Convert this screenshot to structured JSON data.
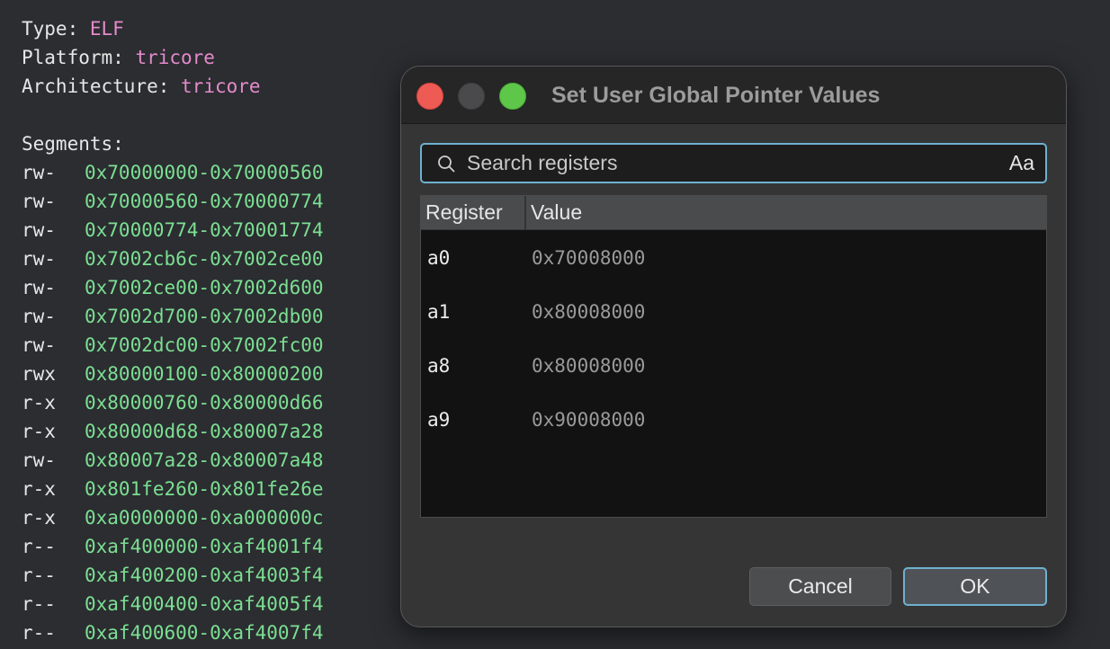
{
  "background": {
    "info": [
      {
        "label": "Type:",
        "value": "ELF"
      },
      {
        "label": "Platform:",
        "value": "tricore"
      },
      {
        "label": "Architecture:",
        "value": "tricore"
      }
    ],
    "segments_label": "Segments:",
    "segments": [
      {
        "perm": "rw-",
        "range": "0x70000000-0x70000560"
      },
      {
        "perm": "rw-",
        "range": "0x70000560-0x70000774"
      },
      {
        "perm": "rw-",
        "range": "0x70000774-0x70001774"
      },
      {
        "perm": "rw-",
        "range": "0x7002cb6c-0x7002ce00"
      },
      {
        "perm": "rw-",
        "range": "0x7002ce00-0x7002d600"
      },
      {
        "perm": "rw-",
        "range": "0x7002d700-0x7002db00"
      },
      {
        "perm": "rw-",
        "range": "0x7002dc00-0x7002fc00"
      },
      {
        "perm": "rwx",
        "range": "0x80000100-0x80000200"
      },
      {
        "perm": "r-x",
        "range": "0x80000760-0x80000d66"
      },
      {
        "perm": "r-x",
        "range": "0x80000d68-0x80007a28"
      },
      {
        "perm": "rw-",
        "range": "0x80007a28-0x80007a48"
      },
      {
        "perm": "r-x",
        "range": "0x801fe260-0x801fe26e"
      },
      {
        "perm": "r-x",
        "range": "0xa0000000-0xa000000c"
      },
      {
        "perm": "r--",
        "range": "0xaf400000-0xaf4001f4"
      },
      {
        "perm": "r--",
        "range": "0xaf400200-0xaf4003f4"
      },
      {
        "perm": "r--",
        "range": "0xaf400400-0xaf4005f4"
      },
      {
        "perm": "r--",
        "range": "0xaf400600-0xaf4007f4"
      }
    ],
    "colors": {
      "value": "#e58acb",
      "range": "#7cdf92"
    }
  },
  "dialog": {
    "title": "Set User Global Pointer Values",
    "search": {
      "placeholder": "Search registers",
      "value": "",
      "case_toggle": "Aa"
    },
    "table": {
      "columns": [
        "Register",
        "Value"
      ],
      "rows": [
        {
          "register": "a0",
          "value": "0x70008000"
        },
        {
          "register": "a1",
          "value": "0x80008000"
        },
        {
          "register": "a8",
          "value": "0x80008000"
        },
        {
          "register": "a9",
          "value": "0x90008000"
        }
      ]
    },
    "buttons": {
      "cancel": "Cancel",
      "ok": "OK"
    },
    "accent": "#6fb1cf"
  }
}
